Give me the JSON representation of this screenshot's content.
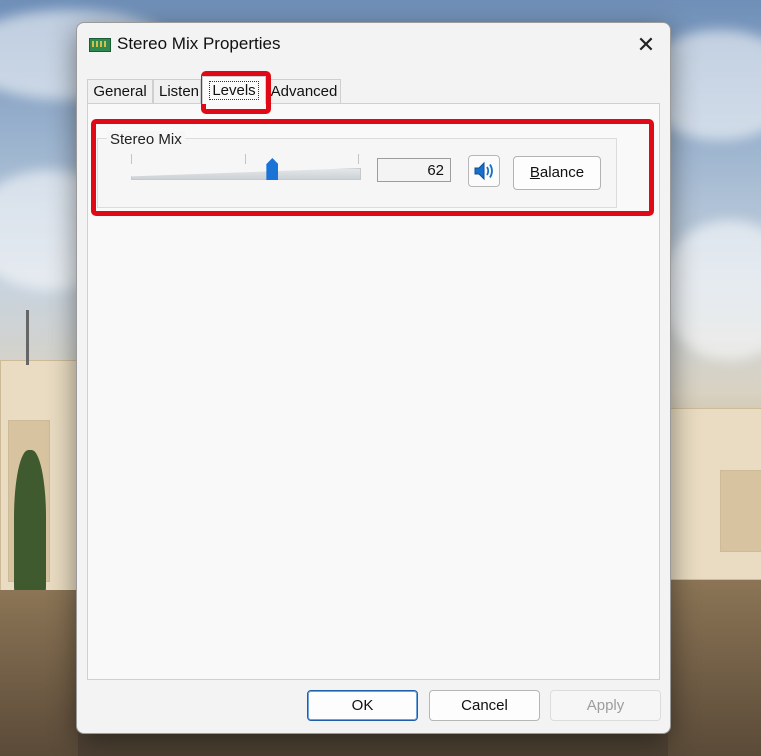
{
  "window": {
    "title": "Stereo Mix Properties",
    "close_glyph": "✕"
  },
  "tabs": [
    {
      "label": "General",
      "active": false
    },
    {
      "label": "Listen",
      "active": false
    },
    {
      "label": "Levels",
      "active": true
    },
    {
      "label": "Advanced",
      "active": false
    }
  ],
  "levels": {
    "group_label": "Stereo Mix",
    "level_value": "62",
    "slider_percent": 62,
    "balance_label": "Balance",
    "speaker_icon": "speaker-volume-icon"
  },
  "buttons": {
    "ok": "OK",
    "cancel": "Cancel",
    "apply": "Apply"
  },
  "colors": {
    "accent": "#1a73d6",
    "highlight": "#e00a17"
  }
}
